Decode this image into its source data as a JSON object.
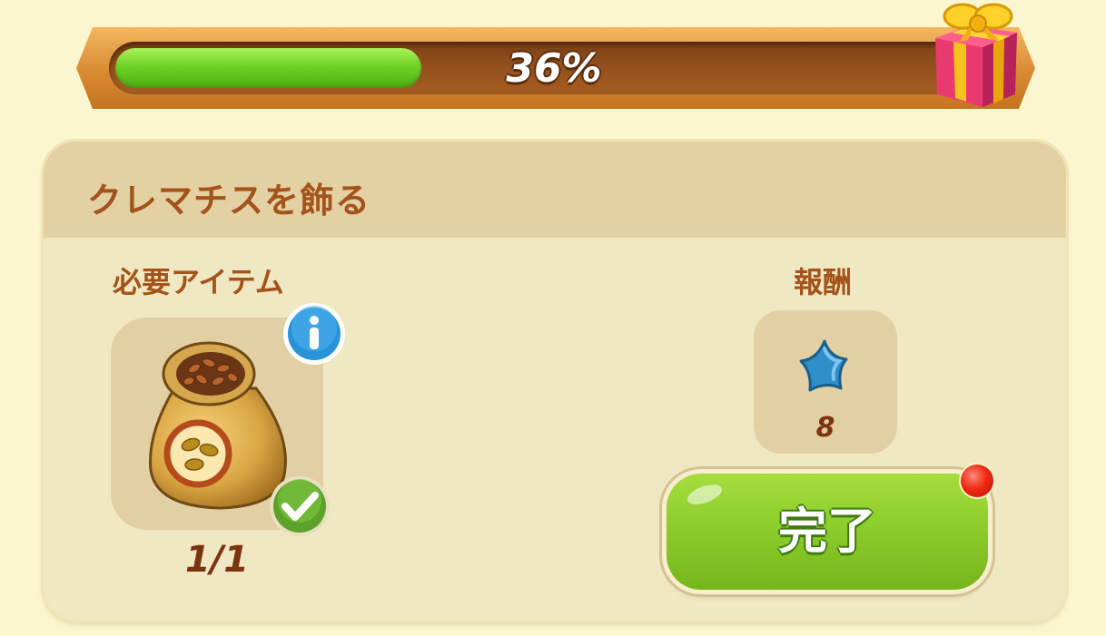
{
  "progress": {
    "label": "36%",
    "fraction": 0.36
  },
  "quest": {
    "title": "クレマチスを飾る",
    "required_label": "必要アイテム",
    "reward_label": "報酬",
    "item": {
      "icon": "seed-bag-icon",
      "count": "1/1"
    },
    "reward": {
      "icon": "blue-star-icon",
      "value": "8"
    },
    "complete_label": "完了"
  },
  "colors": {
    "accent_text": "#a3541b",
    "count_text": "#7c3410",
    "progress_fill": "#6fd225",
    "button_green": "#8acb2a",
    "notify_red": "#f02a14"
  }
}
